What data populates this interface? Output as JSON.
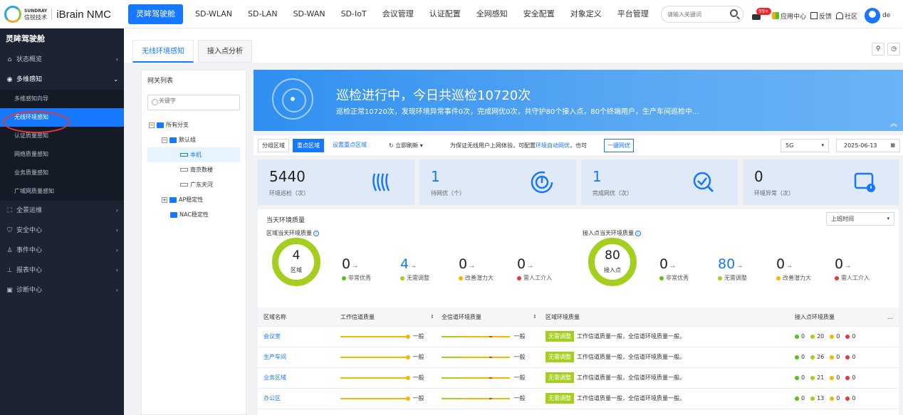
{
  "app": {
    "brand_top": "SUNDRAY",
    "brand_bottom": "信锐技术",
    "name": "iBrain NMC"
  },
  "nav": [
    {
      "label": "灵眸驾驶舱"
    },
    {
      "label": "SD-WLAN"
    },
    {
      "label": "SD-LAN"
    },
    {
      "label": "SD-WAN"
    },
    {
      "label": "SD-IoT"
    },
    {
      "label": "会议管理"
    },
    {
      "label": "认证配置"
    },
    {
      "label": "全网感知"
    },
    {
      "label": "安全配置"
    },
    {
      "label": "对象定义"
    },
    {
      "label": "平台管理"
    }
  ],
  "topbar": {
    "search_placeholder": "请输入关键词",
    "msg_badge": "99+",
    "app_center": "应用中心",
    "feedback": "反馈",
    "community": "社区",
    "user": "de"
  },
  "sidebar": {
    "title": "灵眸驾驶舱",
    "items": [
      {
        "label": "状态概览",
        "icon": "home-icon"
      },
      {
        "label": "多维感知",
        "icon": "eye-icon"
      },
      {
        "label": "全景运维",
        "icon": "expand-icon"
      },
      {
        "label": "安全中心",
        "icon": "shield-icon"
      },
      {
        "label": "事件中心",
        "icon": "person-icon"
      },
      {
        "label": "报表中心",
        "icon": "chart-icon"
      },
      {
        "label": "诊断中心",
        "icon": "diagnose-icon"
      }
    ],
    "sub_items": [
      {
        "label": "多维感知向导"
      },
      {
        "label": "无线环境感知"
      },
      {
        "label": "认证质量感知"
      },
      {
        "label": "网络质量感知"
      },
      {
        "label": "业务质量感知"
      },
      {
        "label": "广域网质量感知"
      }
    ]
  },
  "tabs": [
    {
      "label": "无线环境感知"
    },
    {
      "label": "接入点分析"
    }
  ],
  "gateway": {
    "title": "网关列表",
    "search_placeholder": "关键字",
    "tree": [
      {
        "label": "所有分支"
      },
      {
        "label": "默认组"
      },
      {
        "label": "本机"
      },
      {
        "label": "南京数楼"
      },
      {
        "label": "广东天河"
      },
      {
        "label": "AP稳定性"
      },
      {
        "label": "NAC稳定性"
      }
    ]
  },
  "banner": {
    "title": "巡检进行中，今日共巡检10720次",
    "subtitle": "巡检正常10720次，发现环境异常事件0次，完成网优0次，共守护80个接入点，80个终端用户，生产车间巡检中..."
  },
  "toolbar": {
    "seg1": "分组区域",
    "seg2": "重点区域",
    "seg3": "设置重点区域",
    "refresh": "立即刷新",
    "hint_pre": "为保证无线用户上网体验，可配置",
    "hint_link": "环境自动网优",
    "hint_mid": "，也可",
    "button": "一键网优",
    "band": "5G",
    "date": "2025-06-13"
  },
  "cards": [
    {
      "value": "5440",
      "label": "环境巡检（次）",
      "icon": "scan-wave-icon"
    },
    {
      "value": "1",
      "label": "待网优（个）",
      "icon": "power-timer-icon"
    },
    {
      "value": "1",
      "label": "完成网优（次）",
      "icon": "check-search-icon"
    },
    {
      "value": "0",
      "label": "环境异常（次）",
      "icon": "monitor-alert-icon"
    }
  ],
  "quality": {
    "title": "当天环境质量",
    "filter": "上班时间",
    "region_title": "区域当天环境质量",
    "ap_title": "接入点当天环境质量",
    "region_ring": {
      "value": "4",
      "label": "区域"
    },
    "ap_ring": {
      "value": "80",
      "label": "接入点"
    },
    "region_stats": [
      {
        "value": "0",
        "label": "非常优秀",
        "color": "#52c41a"
      },
      {
        "value": "4",
        "label": "无需调整",
        "color": "#a5cf1f"
      },
      {
        "value": "0",
        "label": "改善潜力大",
        "color": "#f5b800"
      },
      {
        "value": "0",
        "label": "需人工介入",
        "color": "#e53935"
      }
    ],
    "ap_stats": [
      {
        "value": "0",
        "label": "非常优秀",
        "color": "#52c41a"
      },
      {
        "value": "80",
        "label": "无需调整",
        "color": "#a5cf1f"
      },
      {
        "value": "0",
        "label": "改善潜力大",
        "color": "#f5b800"
      },
      {
        "value": "0",
        "label": "需人工介入",
        "color": "#e53935"
      }
    ]
  },
  "table": {
    "headers": [
      "区域名称",
      "工作信道质量",
      "全信道环境质量",
      "区域环境质量",
      "接入点环境质量"
    ],
    "more": "...",
    "rows": [
      {
        "area": "会议室",
        "work": "一般",
        "all": "一般",
        "tag": "无需调整",
        "desc": "工作信道质量一般，全信道环境质量一般。",
        "ap": [
          "0",
          "20",
          "0",
          "0"
        ]
      },
      {
        "area": "生产车间",
        "work": "一般",
        "all": "一般",
        "tag": "无需调整",
        "desc": "工作信道质量一般，全信道环境质量一般。",
        "ap": [
          "0",
          "26",
          "0",
          "0"
        ]
      },
      {
        "area": "业务区域",
        "work": "一般",
        "all": "一般",
        "tag": "无需调整",
        "desc": "工作信道质量一般，全信道环境质量一般。",
        "ap": [
          "0",
          "21",
          "0",
          "0"
        ]
      },
      {
        "area": "办公区",
        "work": "一般",
        "all": "一般",
        "tag": "无需调整",
        "desc": "工作信道质量一般，全信道环境质量一般。",
        "ap": [
          "0",
          "13",
          "0",
          "0"
        ]
      }
    ]
  }
}
